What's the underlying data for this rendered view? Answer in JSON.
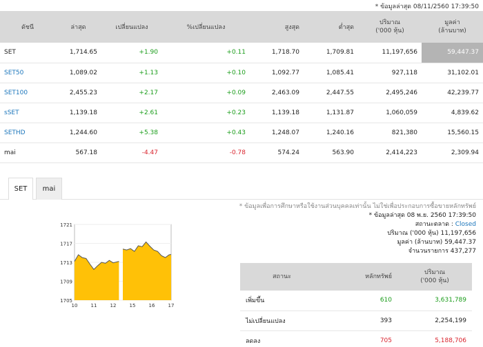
{
  "timestamp": "* ข้อมูลล่าสุด 08/11/2560 17:39:50",
  "index_table": {
    "headers": {
      "symbol": "ดัชนี",
      "last": "ล่าสุด",
      "change": "เปลี่ยนแปลง",
      "pct_change": "%เปลี่ยนแปลง",
      "high": "สูงสุด",
      "low": "ต่ำสุด",
      "volume_line1": "ปริมาณ",
      "volume_line2": "('000 หุ้น)",
      "value_line1": "มูลค่า",
      "value_line2": "(ล้านบาท)"
    },
    "rows": [
      {
        "symbol": "SET",
        "last": "1,714.65",
        "change": "+1.90",
        "pct": "+0.11",
        "high": "1,718.70",
        "low": "1,709.81",
        "volume": "11,197,656",
        "value": "59,447.37"
      },
      {
        "symbol": "SET50",
        "last": "1,089.02",
        "change": "+1.13",
        "pct": "+0.10",
        "high": "1,092.77",
        "low": "1,085.41",
        "volume": "927,118",
        "value": "31,102.01"
      },
      {
        "symbol": "SET100",
        "last": "2,455.23",
        "change": "+2.17",
        "pct": "+0.09",
        "high": "2,463.09",
        "low": "2,447.55",
        "volume": "2,495,246",
        "value": "42,239.77"
      },
      {
        "symbol": "sSET",
        "last": "1,139.18",
        "change": "+2.61",
        "pct": "+0.23",
        "high": "1,139.18",
        "low": "1,131.87",
        "volume": "1,060,059",
        "value": "4,839.62"
      },
      {
        "symbol": "SETHD",
        "last": "1,244.60",
        "change": "+5.38",
        "pct": "+0.43",
        "high": "1,248.07",
        "low": "1,240.16",
        "volume": "821,380",
        "value": "15,560.15"
      },
      {
        "symbol": "mai",
        "last": "567.18",
        "change": "-4.47",
        "pct": "-0.78",
        "high": "574.24",
        "low": "563.90",
        "volume": "2,414,223",
        "value": "2,309.94"
      }
    ]
  },
  "tabs": [
    {
      "label": "SET",
      "active": true
    },
    {
      "label": "mai",
      "active": false
    }
  ],
  "chart_data": {
    "type": "area",
    "x_ticks": [
      "10",
      "11",
      "12",
      "15",
      "16",
      "17"
    ],
    "y_ticks": [
      "1721",
      "1717",
      "1713",
      "1709",
      "1705"
    ],
    "ylim": [
      1705,
      1721
    ],
    "fill_color": "#ffc107",
    "line_color": "#555555",
    "x": [
      10.0,
      10.2,
      10.4,
      10.6,
      10.8,
      11.0,
      11.2,
      11.4,
      11.6,
      11.8,
      12.0,
      12.3,
      14.5,
      14.7,
      14.9,
      15.1,
      15.3,
      15.5,
      15.7,
      15.9,
      16.1,
      16.3,
      16.5,
      16.7,
      16.9,
      17.0
    ],
    "y": [
      1713.2,
      1714.6,
      1714.0,
      1713.8,
      1712.6,
      1711.5,
      1712.3,
      1713.0,
      1712.8,
      1713.4,
      1712.9,
      1713.2,
      1715.8,
      1715.6,
      1715.9,
      1715.3,
      1716.5,
      1716.3,
      1717.3,
      1716.4,
      1715.6,
      1715.3,
      1714.4,
      1714.0,
      1714.6,
      1714.65
    ]
  },
  "info": {
    "note": "* ข้อมูลเพื่อการศึกษาหรือใช้งานส่วนบุคคลเท่านั้น ไม่ใช่เพื่อประกอบการซื้อขายหลักทรัพย์",
    "updated": "* ข้อมูลล่าสุด 08 พ.ย. 2560 17:39:50",
    "market_status_label": "สถานะตลาด :",
    "market_status": "Closed",
    "volume_label": "ปริมาณ ('000 หุ้น)",
    "volume": "11,197,656",
    "value_label": "มูลค่า (ล้านบาท)",
    "value": "59,447.37",
    "trades_label": "จำนวนรายการ",
    "trades": "437,277"
  },
  "breadth_table": {
    "headers": {
      "status": "สถานะ",
      "securities": "หลักทรัพย์",
      "volume_line1": "ปริมาณ",
      "volume_line2": "('000 หุ้น)"
    },
    "rows": [
      {
        "label": "เพิ่มขึ้น",
        "count": "610",
        "volume": "3,631,789",
        "color": "#1a9c1a"
      },
      {
        "label": "ไม่เปลี่ยนแปลง",
        "count": "393",
        "volume": "2,254,199",
        "color": "#222222"
      },
      {
        "label": "ลดลง",
        "count": "705",
        "volume": "5,188,706",
        "color": "#d9232d"
      }
    ]
  }
}
